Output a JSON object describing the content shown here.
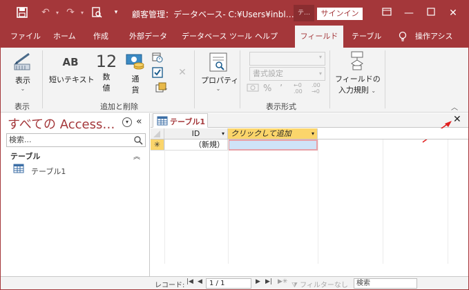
{
  "titlebar": {
    "title": "顧客管理：データベース- C:¥Users¥inbl…",
    "context_tab": "テ…",
    "signin_label": "サインイン"
  },
  "tabs": [
    "ファイル",
    "ホーム",
    "作成",
    "外部データ",
    "データベース ツール",
    "ヘルプ",
    "フィールド",
    "テーブル",
    "操作アシス"
  ],
  "ribbon": {
    "view_label": "表示",
    "view_group": "表示",
    "short_text_icon": "AB",
    "short_text_label": "短いテキスト",
    "number_icon": "12",
    "number_label_1": "数",
    "number_label_2": "値",
    "currency_label_1": "通",
    "currency_label_2": "貨",
    "add_delete_group": "追加と削除",
    "properties_label": "プロパティ",
    "format_dropdown": "書式設定",
    "format_group": "表示形式",
    "percent_symbol": "%",
    "comma_symbol": "’",
    "increase_decimals": "←0\n.00",
    "decrease_decimals": ".00\n→0",
    "validation_label_1": "フィールドの",
    "validation_label_2": "入力規則"
  },
  "nav": {
    "title": "すべての Access…",
    "search_placeholder": "検索...",
    "group_label": "テーブル",
    "items": [
      {
        "label": "テーブル1"
      }
    ]
  },
  "doc": {
    "tab_label": "テーブル1",
    "columns": [
      {
        "label": "ID"
      },
      {
        "label": "クリックして追加"
      }
    ],
    "new_row_marker": "✳",
    "new_row_id": "（新規）"
  },
  "record_nav": {
    "label": "レコード:",
    "position": "1 / 1",
    "filter_label": "フィルターなし",
    "search_label": "検索"
  },
  "colors": {
    "accent": "#a4373a",
    "highlight_header": "#fbd56b",
    "selected_cell": "#cfe3f7"
  }
}
